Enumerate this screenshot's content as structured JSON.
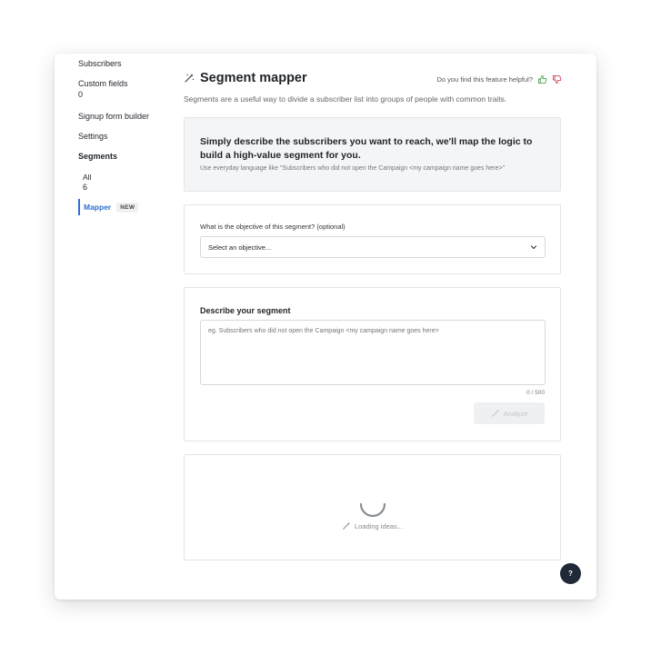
{
  "sidebar": {
    "subscribers": "Subscribers",
    "custom_fields": "Custom fields",
    "custom_fields_count": "0",
    "signup_form_builder": "Signup form builder",
    "settings": "Settings",
    "segments": "Segments",
    "all": "All",
    "all_count": "6",
    "mapper": "Mapper",
    "mapper_badge": "NEW"
  },
  "header": {
    "title": "Segment mapper",
    "feedback_question": "Do you find this feature helpful?",
    "subtitle": "Segments are a useful way to divide a subscriber list into groups of people with common traits."
  },
  "hero": {
    "heading": "Simply describe the subscribers you want to reach, we'll map the logic to build a high-value segment for you.",
    "hint": "Use everyday language like \"Subscribers who did not open the Campaign <my campaign name goes here>\""
  },
  "objective": {
    "label": "What is the objective of this segment? (optional)",
    "selected": "Select an objective..."
  },
  "describe": {
    "title": "Describe your segment",
    "placeholder": "eg. Subscribers who did not open the Campaign <my campaign name goes here>",
    "value": "",
    "counter": "0 / 500",
    "analyze_label": "Analyze"
  },
  "loading": {
    "text": "Loading ideas..."
  },
  "help": {
    "label": "?"
  },
  "colors": {
    "accent": "#2f6fd1",
    "thumb_up": "#3a9a3a",
    "thumb_down": "#d0344a",
    "help_bg": "#1f2937"
  }
}
